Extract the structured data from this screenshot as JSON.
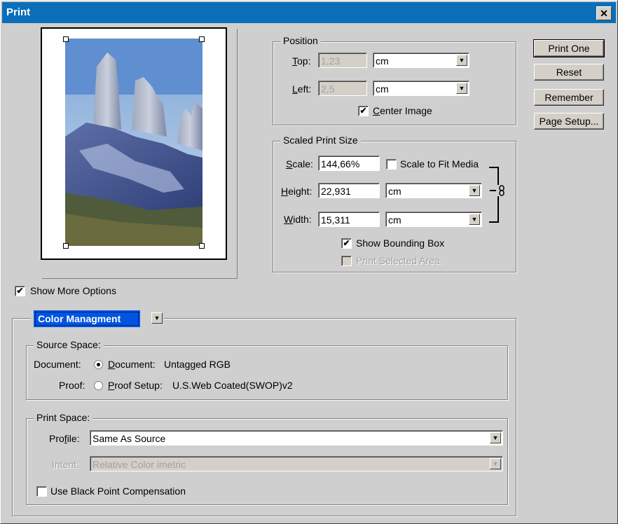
{
  "window": {
    "title": "Print",
    "close_glyph": "✕"
  },
  "buttons": {
    "print_one": "Print One",
    "reset": "Reset",
    "remember": "Remember",
    "page_setup": "Page Setup..."
  },
  "position": {
    "title": "Position",
    "top_label": "Top:",
    "top_value": "1,23",
    "top_unit": "cm",
    "left_label": "Left:",
    "left_value": "2,5",
    "left_unit": "cm",
    "center_image_label": "Center Image",
    "center_image_checked": true
  },
  "scaled": {
    "title": "Scaled Print Size",
    "scale_label": "Scale:",
    "scale_value": "144,66%",
    "scale_to_fit_label": "Scale to Fit Media",
    "height_label": "Height:",
    "height_value": "22,931",
    "height_unit": "cm",
    "width_label": "Width:",
    "width_value": "15,311",
    "width_unit": "cm",
    "show_bounding_box_label": "Show Bounding Box",
    "print_selected_area_label": "Print Selected Area"
  },
  "more_options": {
    "label": "Show More Options"
  },
  "color": {
    "section_select": "Color Managment",
    "source_title": "Source Space:",
    "document_label": "Document:",
    "document_option": "Document:",
    "document_value": "Untagged RGB",
    "proof_label": "Proof:",
    "proof_option": "Proof Setup:",
    "proof_value": "U.S.Web Coated(SWOP)v2",
    "print_title": "Print Space:",
    "profile_label": "Profile:",
    "profile_value": "Same As Source",
    "intent_label": "Intent:",
    "intent_value": "Relative Color imetric",
    "bpc_label": "Use Black Point Compensation"
  },
  "icons": {
    "dropdown": "▼",
    "check": "✔",
    "link": "chain-link-icon"
  },
  "colors": {
    "titlebar": "#0a6fb8",
    "dialog_bg": "#cfcfcf",
    "selected": "#0054e3"
  }
}
